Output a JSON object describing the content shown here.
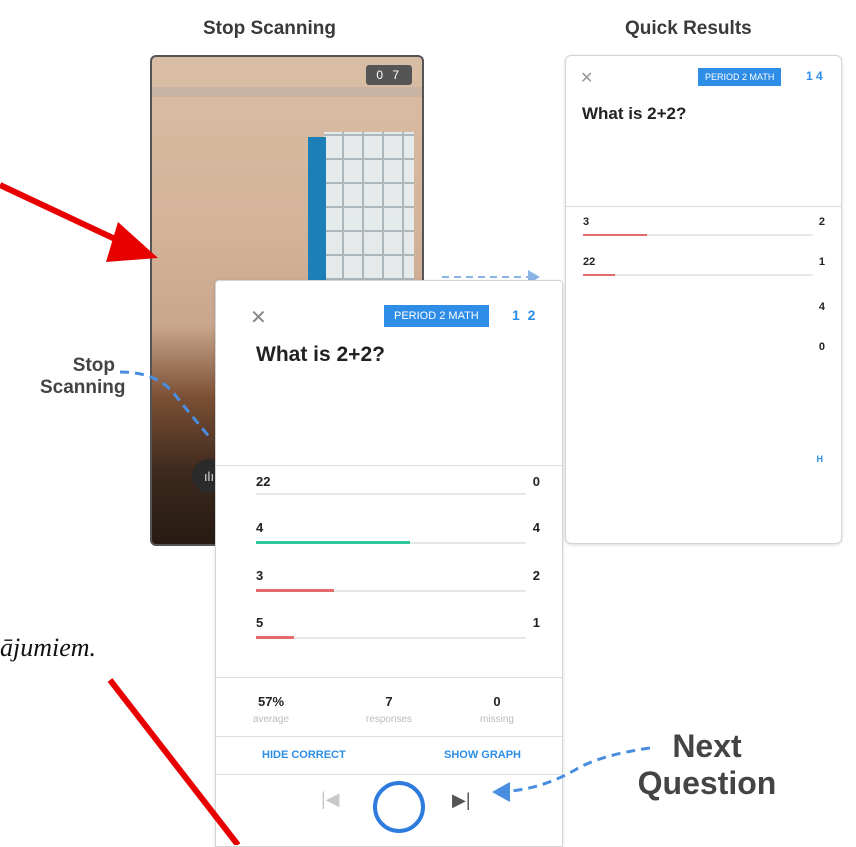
{
  "titles": {
    "stop_scanning": "Stop Scanning",
    "quick_results": "Quick Results"
  },
  "labels": {
    "stop_scanning_line1": "Stop",
    "stop_scanning_line2": "Scanning",
    "next_question_line1": "Next",
    "next_question_line2": "Question"
  },
  "camera": {
    "counter": "0 7"
  },
  "results_back": {
    "badge": "PERIOD 2 MATH",
    "count": "1 4",
    "question": "What is 2+2?",
    "rows": [
      {
        "label": "3",
        "count": "2",
        "fraction": 0.28
      },
      {
        "label": "22",
        "count": "1",
        "fraction": 0.14
      }
    ],
    "extra_counts": [
      "4",
      "0"
    ],
    "link_fragment": "H"
  },
  "results_front": {
    "badge": "PERIOD 2 MATH",
    "count": "1 2",
    "question": "What is 2+2?",
    "rows": [
      {
        "label": "22",
        "count": "0",
        "fraction": 0.0,
        "correct": false
      },
      {
        "label": "4",
        "count": "4",
        "fraction": 0.57,
        "correct": true
      },
      {
        "label": "3",
        "count": "2",
        "fraction": 0.29,
        "correct": false
      },
      {
        "label": "5",
        "count": "1",
        "fraction": 0.14,
        "correct": false
      }
    ],
    "stats": [
      {
        "value": "57%",
        "label": "average"
      },
      {
        "value": "7",
        "label": "responses"
      },
      {
        "value": "0",
        "label": "missing"
      }
    ],
    "hide_correct": "HIDE CORRECT",
    "show_graph": "SHOW GRAPH"
  },
  "colors": {
    "accent": "#2e8de6",
    "correct": "#2ec99b",
    "incorrect": "#e36a6a",
    "arrow": "#e80000",
    "dash": "#4a8ee0"
  },
  "bottom_text": "ājumiem."
}
